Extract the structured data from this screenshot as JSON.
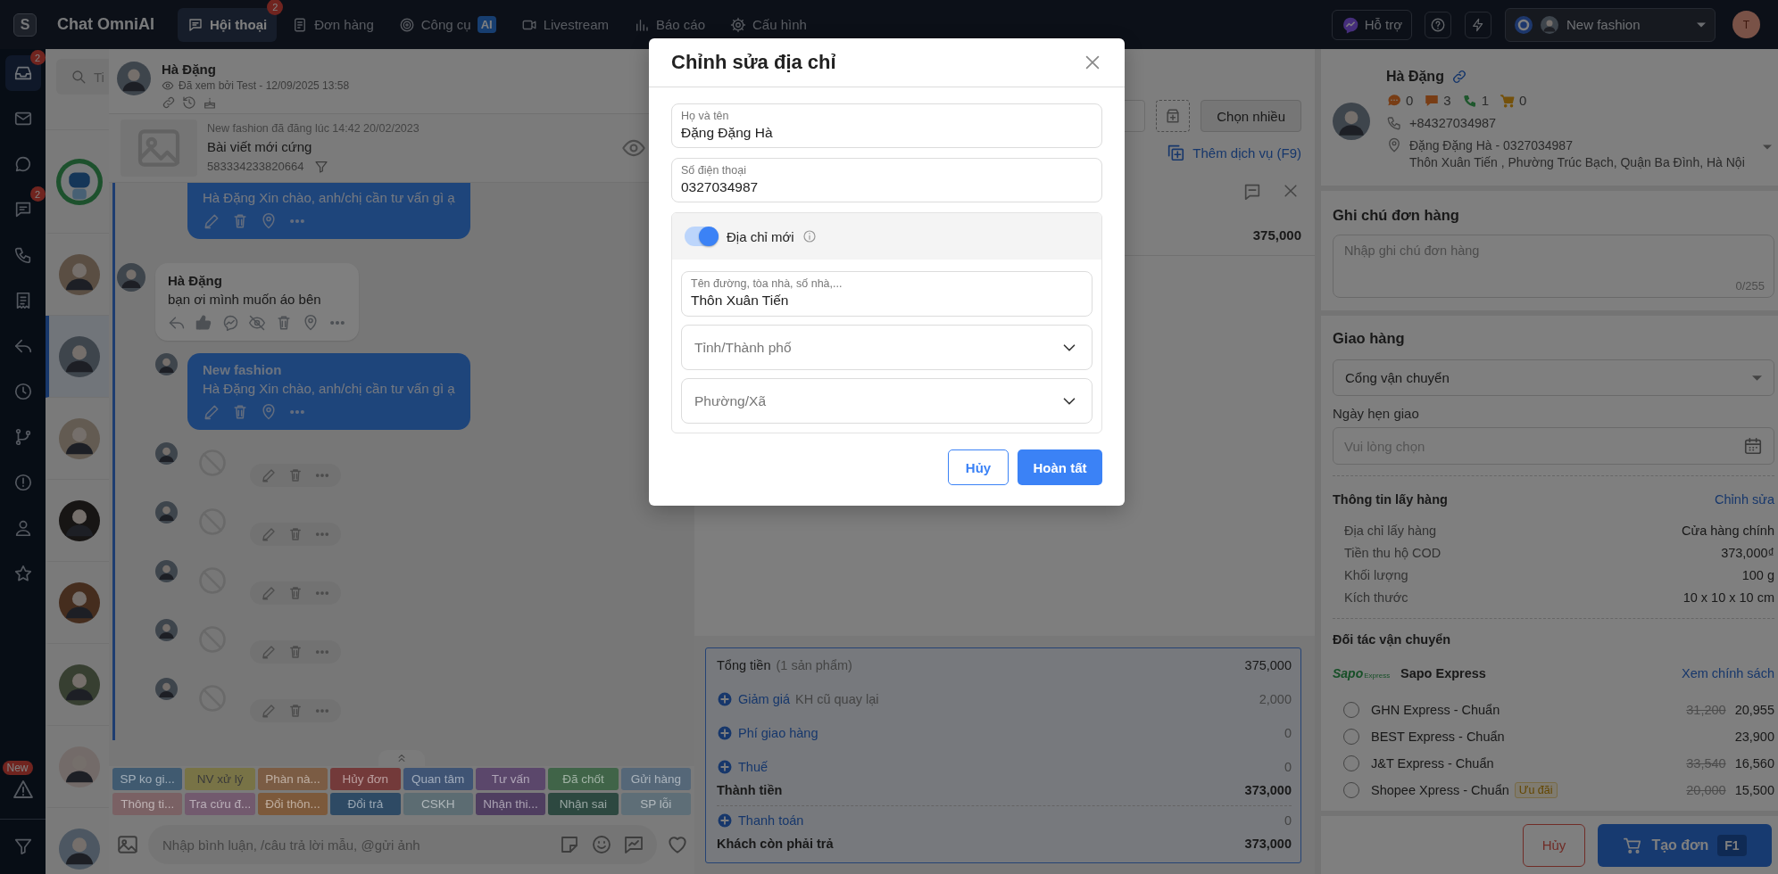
{
  "topbar": {
    "logo": "S",
    "app_name": "Chat OmniAI",
    "nav": [
      {
        "label": "Hội thoại",
        "selected": true,
        "badge": "2"
      },
      {
        "label": "Đơn hàng",
        "selected": false
      },
      {
        "label": "Công cụ",
        "selected": false,
        "tag": "AI"
      },
      {
        "label": "Livestream",
        "selected": false
      },
      {
        "label": "Báo cáo",
        "selected": false
      },
      {
        "label": "Cấu hình",
        "selected": false
      }
    ],
    "support": "Hỗ trợ",
    "page": "New fashion",
    "user_initial": "T"
  },
  "rail": {
    "items": [
      {
        "selected": true,
        "badge": "2"
      },
      {
        "selected": false
      },
      {
        "selected": false
      },
      {
        "selected": false,
        "badge": "2"
      },
      {
        "selected": false
      },
      {
        "selected": false
      },
      {
        "selected": false
      },
      {
        "selected": false
      },
      {
        "selected": false
      },
      {
        "selected": false
      },
      {
        "selected": false
      },
      {
        "selected": false
      }
    ],
    "footer": {
      "badge": "New"
    }
  },
  "conversations": {
    "search_placeholder": "Ti",
    "items": [
      {
        "kind": "bot",
        "selected": false
      },
      {
        "kind": "person",
        "selected": false
      },
      {
        "kind": "person",
        "selected": true
      },
      {
        "kind": "person",
        "selected": false
      },
      {
        "kind": "person",
        "selected": false
      },
      {
        "kind": "person",
        "selected": false
      },
      {
        "kind": "person",
        "selected": false
      },
      {
        "kind": "person",
        "selected": false
      },
      {
        "kind": "person",
        "selected": false
      }
    ]
  },
  "chat": {
    "contact": "Hà Đặng",
    "seen": "Đã xem bởi Test - 12/09/2025 13:58",
    "post": {
      "meta": "New fashion đã đăng lúc 14:42 20/02/2023",
      "title": "Bài viết mới cứng",
      "id": "583334233820664"
    },
    "messages": [
      {
        "kind": "outgoing",
        "text": "Hà Đặng Xin chào, anh/chị cần tư vấn gì ạ"
      },
      {
        "kind": "incoming",
        "sender": "Hà Đặng",
        "text": "bạn ơi mình muốn áo bên"
      },
      {
        "kind": "outgoing",
        "sender": "New fashion",
        "text": "Hà Đặng Xin chào, anh/chị cần tư vấn gì ạ"
      },
      {
        "kind": "deleted"
      },
      {
        "kind": "deleted"
      },
      {
        "kind": "deleted"
      },
      {
        "kind": "deleted"
      },
      {
        "kind": "deleted"
      }
    ],
    "tags": [
      {
        "label": "SP ko gi...",
        "color": "#405a70"
      },
      {
        "label": "NV xử lý",
        "color": "#787346"
      },
      {
        "label": "Phàn nà...",
        "color": "#7b5c44"
      },
      {
        "label": "Hủy đơn",
        "color": "#733a3a"
      },
      {
        "label": "Quan tâm",
        "color": "#3f5474"
      },
      {
        "label": "Tư vấn",
        "color": "#5b476b"
      },
      {
        "label": "Đã chốt",
        "color": "#406448"
      },
      {
        "label": "Gửi hàng",
        "color": "#556778"
      },
      {
        "label": "Thông ti...",
        "color": "#7a6164"
      },
      {
        "label": "Tra cứu đ...",
        "color": "#725a6e"
      },
      {
        "label": "Đổi thôn...",
        "color": "#7c593b"
      },
      {
        "label": "Đổi trả",
        "color": "#2e4a64"
      },
      {
        "label": "CSKH",
        "color": "#5c6c72"
      },
      {
        "label": "Nhận thi...",
        "color": "#4f3e60"
      },
      {
        "label": "Nhận sai",
        "color": "#2d4840"
      },
      {
        "label": "SP lỗi",
        "color": "#5e6e77"
      }
    ],
    "composer_placeholder": "Nhập bình luận, /câu trả lời mẫu, @gửi ảnh"
  },
  "order": {
    "multi_select": "Chọn nhiều",
    "add_service": "Thêm dịch vụ (F9)",
    "line_total": "375,000",
    "summary": [
      {
        "kind": "plain",
        "label": "Tổng tiền",
        "note": "(1 sản phẩm)",
        "value": "375,000"
      },
      {
        "kind": "add",
        "label": "Giảm giá",
        "note": "KH cũ quay lại",
        "value": "2,000"
      },
      {
        "kind": "add",
        "label": "Phí giao hàng",
        "value": "0"
      },
      {
        "kind": "add",
        "label": "Thuế",
        "value": "0"
      },
      {
        "kind": "total",
        "label": "Thành tiền",
        "value": "373,000"
      },
      {
        "kind": "add",
        "label": "Thanh toán",
        "value": "0"
      },
      {
        "kind": "total",
        "label": "Khách còn phải trả",
        "value": "373,000"
      }
    ]
  },
  "customer_panel": {
    "customer": {
      "name": "Hà Đặng",
      "stats": [
        "0",
        "3",
        "1",
        "0"
      ],
      "phone": "+84327034987",
      "address_name": "Đặng Đặng Hà - 0327034987",
      "address": "Thôn Xuân Tiến , Phường Trúc Bạch, Quận Ba Đình, Hà Nội"
    },
    "note": {
      "title": "Ghi chú đơn hàng",
      "placeholder": "Nhập ghi chú đơn hàng",
      "counter": "0/255"
    },
    "shipping": {
      "title": "Giao hàng",
      "method": "Cổng vận chuyển",
      "date_label": "Ngày hẹn giao",
      "date_placeholder": "Vui lòng chọn"
    },
    "pickup": {
      "title": "Thông tin lấy hàng",
      "edit": "Chỉnh sửa",
      "rows": [
        {
          "label": "Địa chỉ lấy hàng",
          "value": "Cửa hàng chính"
        },
        {
          "label": "Tiền thu hộ COD",
          "value": "373,000₫"
        },
        {
          "label": "Khối lượng",
          "value": "100 g"
        },
        {
          "label": "Kích thước",
          "value": "10 x 10 x 10 cm"
        }
      ]
    },
    "partners": {
      "title": "Đối tác vận chuyển",
      "logo": "Sapo",
      "logo_sub": "Express",
      "provider": "Sapo Express",
      "policy": "Xem chính sách",
      "options": [
        {
          "name": "GHN Express - Chuẩn",
          "old_price": "31,200",
          "price": "20,955",
          "selected": false
        },
        {
          "name": "BEST Express - Chuẩn",
          "price": "23,900",
          "selected": false
        },
        {
          "name": "J&T Express - Chuẩn",
          "old_price": "33,540",
          "price": "16,560",
          "selected": false
        },
        {
          "name": "Shopee Xpress - Chuẩn",
          "tag": "Ưu đãi",
          "old_price": "20,000",
          "price": "15,500",
          "selected": false
        }
      ]
    },
    "actions": {
      "cancel": "Hủy",
      "create": "Tạo đơn",
      "shortcut": "F1"
    }
  },
  "address_modal": {
    "title": "Chỉnh sửa địa chỉ",
    "fields": [
      {
        "label": "Họ và tên",
        "value": "Đặng Đặng Hà"
      },
      {
        "label": "Số điện thoại",
        "value": "0327034987"
      }
    ],
    "toggle": {
      "label": "Địa chỉ mới",
      "on": true
    },
    "street": {
      "label": "Tên đường, tòa nhà, số nhà,...",
      "value": "Thôn Xuân Tiến"
    },
    "selects": [
      {
        "placeholder": "Tỉnh/Thành phố"
      },
      {
        "placeholder": "Phường/Xã"
      }
    ],
    "cancel": "Hủy",
    "confirm": "Hoàn tất"
  }
}
